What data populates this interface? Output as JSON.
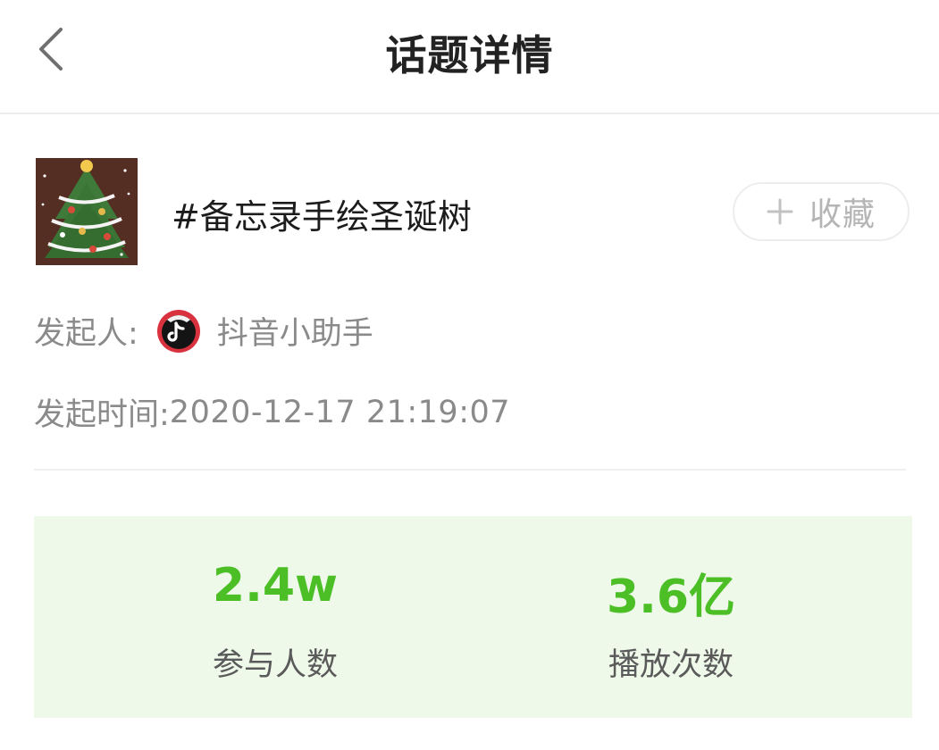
{
  "header": {
    "title": "话题详情",
    "back_icon": "chevron-left-icon"
  },
  "topic": {
    "title": "#备忘录手绘圣诞树",
    "cover_image": "christmas-tree-thumbnail",
    "collect_button": {
      "icon": "plus-icon",
      "label": "收藏"
    }
  },
  "info": {
    "initiator_label": "发起人:",
    "initiator_avatar": "douyin-logo-avatar",
    "initiator_name": "抖音小助手",
    "time_label": "发起时间:",
    "time_value": "2020-12-17 21:19:07"
  },
  "stats": [
    {
      "value": "2.4w",
      "label": "参与人数"
    },
    {
      "value": "3.6亿",
      "label": "播放次数"
    }
  ],
  "colors": {
    "accent_green": "#4cbf26",
    "stats_background": "#eef9ea",
    "muted_text": "#8a8a8a"
  }
}
